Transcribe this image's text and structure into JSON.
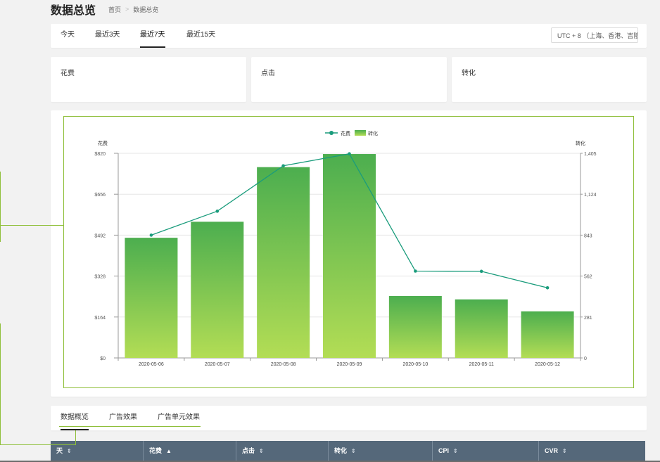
{
  "header": {
    "title": "数据总览",
    "breadcrumb": [
      "首页",
      "数据总览"
    ],
    "separator": ">"
  },
  "range_tabs": [
    {
      "label": "今天",
      "active": false
    },
    {
      "label": "最近3天",
      "active": false
    },
    {
      "label": "最近7天",
      "active": true
    },
    {
      "label": "最近15天",
      "active": false
    }
  ],
  "timezone": {
    "value": "UTC + 8 （上海、香港、吉隆",
    "chevron": "chevron-down-icon"
  },
  "metrics": [
    {
      "label": "花费"
    },
    {
      "label": "点击"
    },
    {
      "label": "转化"
    }
  ],
  "chart_data": {
    "type": "bar",
    "categories": [
      "2020-05-06",
      "2020-05-07",
      "2020-05-08",
      "2020-05-09",
      "2020-05-10",
      "2020-05-11",
      "2020-05-12"
    ],
    "series": [
      {
        "name": "转化",
        "type": "bar",
        "axis": "right",
        "values": [
          825,
          935,
          1310,
          1400,
          425,
          402,
          320
        ]
      },
      {
        "name": "花费",
        "type": "line",
        "axis": "left",
        "values": [
          492,
          588,
          770,
          818,
          348,
          347,
          281
        ]
      }
    ],
    "y_left": {
      "label": "花费",
      "ticks": [
        "$0",
        "$164",
        "$328",
        "$492",
        "$656",
        "$820"
      ],
      "min": 0,
      "max": 820
    },
    "y_right": {
      "label": "转化",
      "ticks": [
        "0",
        "281",
        "562",
        "843",
        "1,124",
        "1,405"
      ],
      "min": 0,
      "max": 1405
    },
    "legend": [
      "花费",
      "转化"
    ],
    "legend_position": "top-center",
    "grid": true,
    "colors": {
      "bar_top": "#4cae4f",
      "bar_bottom": "#b3dd55",
      "line": "#1a9c7c"
    }
  },
  "bottom_tabs": [
    {
      "label": "数据概览",
      "active": true
    },
    {
      "label": "广告效果",
      "active": false
    },
    {
      "label": "广告单元效果",
      "active": false
    }
  ],
  "table": {
    "columns": [
      {
        "label": "天",
        "sort": "⇕"
      },
      {
        "label": "花费",
        "sort": "▲"
      },
      {
        "label": "点击",
        "sort": "⇕"
      },
      {
        "label": "转化",
        "sort": "⇕"
      },
      {
        "label": "CPI",
        "sort": "⇕"
      },
      {
        "label": "CVR",
        "sort": "⇕"
      }
    ]
  }
}
